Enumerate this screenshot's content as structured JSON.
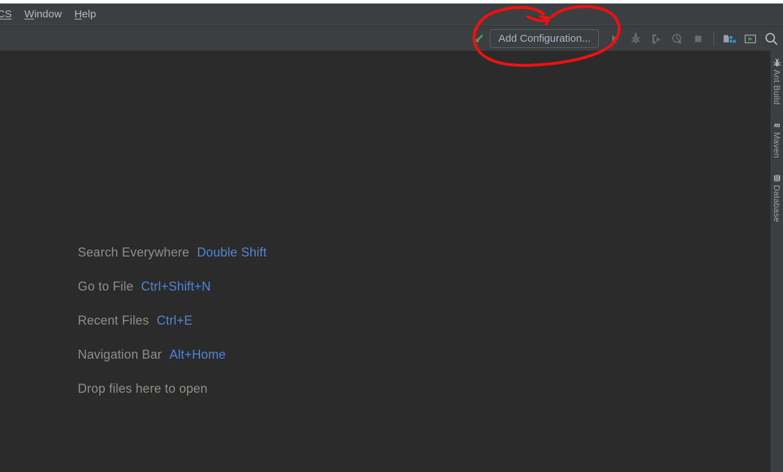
{
  "window": {
    "theme_background": "#2b2b2b",
    "chrome_background": "#3c3f41",
    "accent_blue": "#4e86d6",
    "annotation_color": "#ee1111"
  },
  "menu_bar": {
    "items": [
      {
        "label": "CS",
        "mnemonic": "CS",
        "truncated": true
      },
      {
        "label": "Window",
        "mnemonic": "W"
      },
      {
        "label": "Help",
        "mnemonic": "H"
      }
    ]
  },
  "toolbar": {
    "build_icon_name": "build-hammer-icon",
    "add_configuration_label": "Add Configuration...",
    "buttons": [
      {
        "name": "run-button",
        "icon": "play-icon",
        "enabled": false
      },
      {
        "name": "debug-button",
        "icon": "bug-icon",
        "enabled": false
      },
      {
        "name": "run-with-coverage-button",
        "icon": "run-coverage-icon",
        "enabled": false
      },
      {
        "name": "profile-button",
        "icon": "profiler-icon",
        "enabled": false
      },
      {
        "name": "stop-button",
        "icon": "stop-square-icon",
        "enabled": false
      },
      {
        "name": "project-structure-button",
        "icon": "project-structure-icon",
        "enabled": true
      },
      {
        "name": "terminal-button",
        "icon": "terminal-icon",
        "enabled": true
      },
      {
        "name": "search-everywhere-button",
        "icon": "search-icon",
        "enabled": true
      }
    ]
  },
  "editor": {
    "hints": [
      {
        "label": "Search Everywhere",
        "shortcut": "Double Shift"
      },
      {
        "label": "Go to File",
        "shortcut": "Ctrl+Shift+N"
      },
      {
        "label": "Recent Files",
        "shortcut": "Ctrl+E"
      },
      {
        "label": "Navigation Bar",
        "shortcut": "Alt+Home"
      },
      {
        "label": "Drop files here to open",
        "shortcut": ""
      }
    ]
  },
  "right_tool_strip": {
    "items": [
      {
        "label": "Ant Build",
        "icon": "ant-build-icon"
      },
      {
        "label": "Maven",
        "icon": "maven-icon"
      },
      {
        "label": "Database",
        "icon": "database-icon"
      }
    ]
  },
  "annotation": {
    "shape": "hand-drawn-circle",
    "target": "Add Configuration..."
  }
}
